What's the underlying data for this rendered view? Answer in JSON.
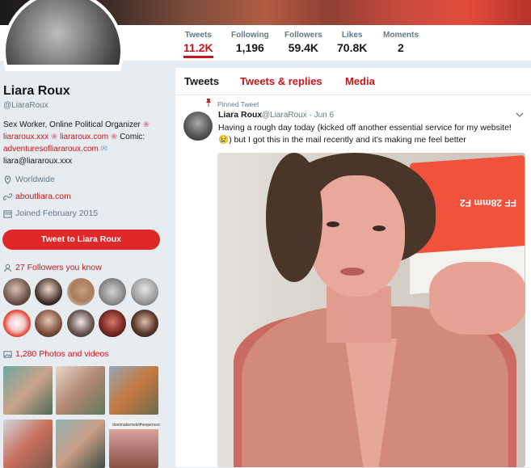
{
  "profile": {
    "name": "Liara Roux",
    "handle": "@LiaraRoux",
    "bio_prefix": "Sex Worker, Online Political Organizer",
    "bio_link1": "liararoux.xxx",
    "bio_link2": "liararoux.com",
    "bio_comic": "Comic:",
    "bio_link3": "adventuresofliararoux.com",
    "bio_email": "liara@liararoux.xxx",
    "location": "Worldwide",
    "website": "aboutliara.com",
    "joined": "Joined February 2015",
    "tweet_to_label": "Tweet to Liara Roux",
    "followers_you_know": "27 Followers you know",
    "photos_videos": "1,280 Photos and videos",
    "thumb_caption": "dontmakemekiltheeperson"
  },
  "stats": [
    {
      "label": "Tweets",
      "value": "11.2K",
      "active": true
    },
    {
      "label": "Following",
      "value": "1,196"
    },
    {
      "label": "Followers",
      "value": "59.4K"
    },
    {
      "label": "Likes",
      "value": "70.8K"
    },
    {
      "label": "Moments",
      "value": "2"
    }
  ],
  "tabs": {
    "tweets": "Tweets",
    "replies": "Tweets & replies",
    "media": "Media"
  },
  "tweet": {
    "pinned_label": "Pinned Tweet",
    "author": "Liara Roux",
    "meta": "@LiaraRoux · Jun 6",
    "text": "Having a rough day today (kicked off another essential service for my website! 😢) but I got this in the mail recently and it's making me feel better",
    "box_text": "FF 28mm F2"
  },
  "colors": {
    "accent": "#c4161c",
    "button": "#e02828",
    "background": "#e6ecf0"
  }
}
